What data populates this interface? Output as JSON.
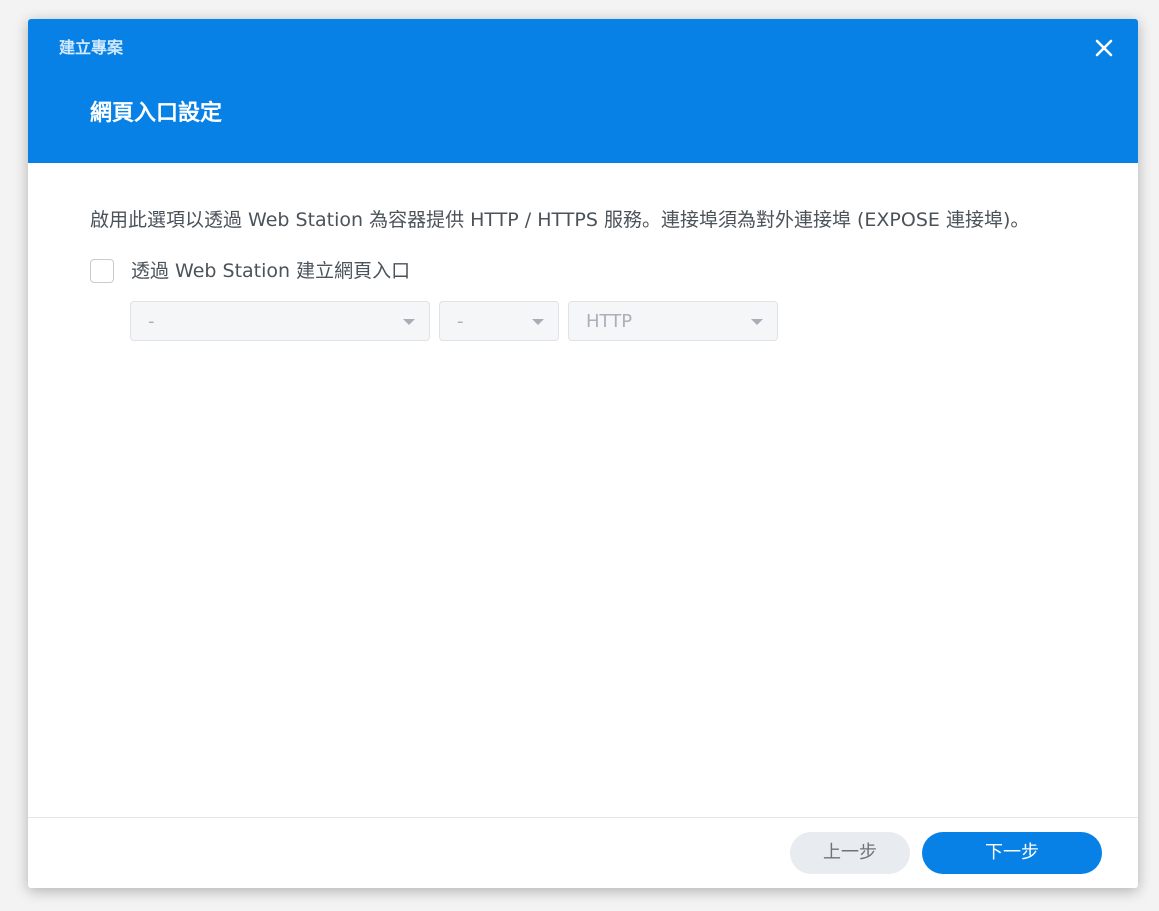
{
  "dialog": {
    "window_title": "建立專案",
    "step_title": "網頁入口設定",
    "close_icon": "close-icon"
  },
  "content": {
    "description": "啟用此選項以透過 Web Station 為容器提供 HTTP / HTTPS 服務。連接埠須為對外連接埠 (EXPOSE 連接埠)。",
    "checkbox": {
      "label": "透過 Web Station 建立網頁入口",
      "checked": false
    },
    "selects": [
      {
        "value": "-"
      },
      {
        "value": "-"
      },
      {
        "value": "HTTP"
      }
    ]
  },
  "footer": {
    "prev_label": "上一步",
    "next_label": "下一步"
  },
  "colors": {
    "accent": "#0781e6",
    "text": "#4b535a",
    "disabled_text": "#aab0b7"
  }
}
